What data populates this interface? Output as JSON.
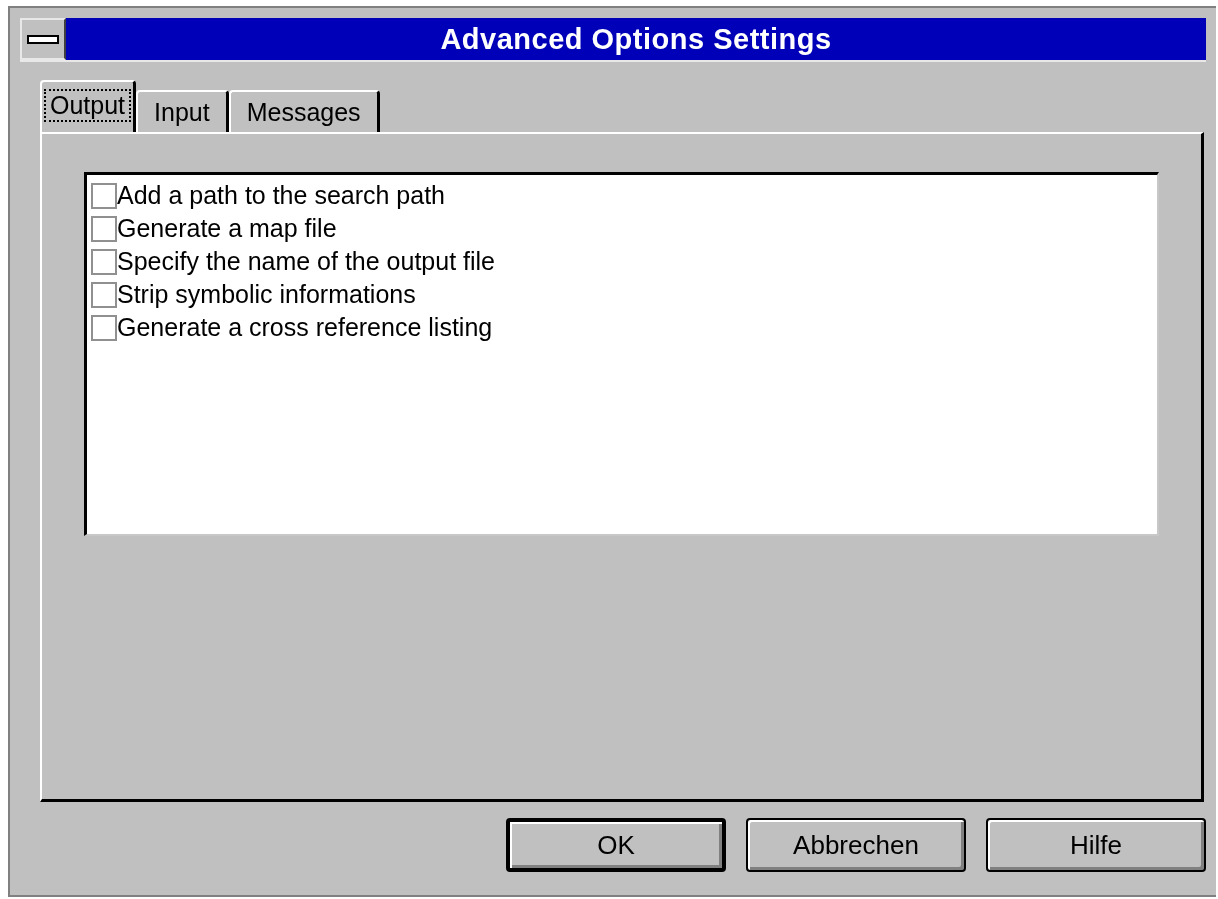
{
  "window": {
    "title": "Advanced Options Settings"
  },
  "tabs": [
    {
      "label": "Output",
      "selected": true
    },
    {
      "label": "Input",
      "selected": false
    },
    {
      "label": "Messages",
      "selected": false
    }
  ],
  "options": [
    {
      "label": "Add a path to the search path",
      "checked": false
    },
    {
      "label": "Generate a map file",
      "checked": false
    },
    {
      "label": "Specify the name of the output file",
      "checked": false
    },
    {
      "label": "Strip symbolic informations",
      "checked": false
    },
    {
      "label": "Generate a cross reference listing",
      "checked": false
    }
  ],
  "buttons": [
    {
      "label": "OK",
      "default": true
    },
    {
      "label": "Abbrechen",
      "default": false
    },
    {
      "label": "Hilfe",
      "default": false
    }
  ]
}
